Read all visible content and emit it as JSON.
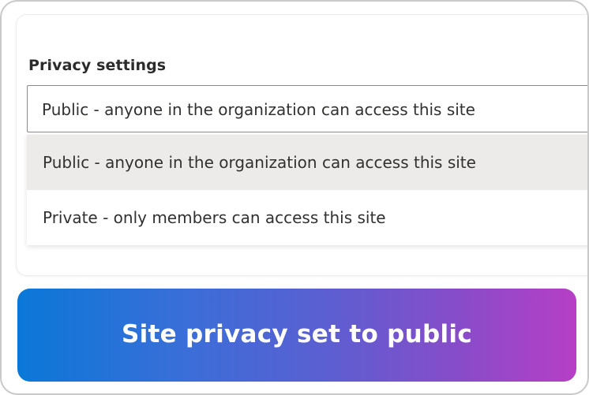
{
  "privacy": {
    "label": "Privacy settings",
    "selected_value": "Public - anyone in the organization can access this site",
    "options": [
      {
        "label": "Public - anyone in the organization can access this site",
        "highlighted": true
      },
      {
        "label": "Private - only members can access this site",
        "highlighted": false
      }
    ]
  },
  "banner": {
    "text": "Site privacy set to public"
  },
  "colors": {
    "option_highlight": "#edebe9",
    "banner_gradient_start": "#0a78d7",
    "banner_gradient_end": "#b73fc6",
    "text": "#323130"
  }
}
